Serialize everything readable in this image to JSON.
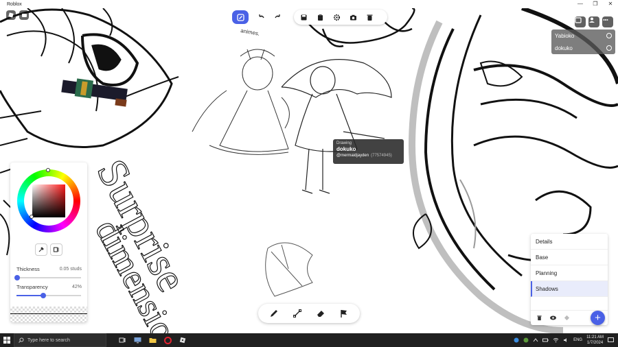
{
  "window": {
    "title": "Roblox",
    "controls": [
      "—",
      "❐",
      "✕"
    ]
  },
  "canvas_text": {
    "big_word_1": "Surprise",
    "big_word_2": "dimension",
    "small_note": "animes."
  },
  "players": [
    {
      "name": "Yabioko"
    },
    {
      "name": "dokuko"
    }
  ],
  "tooltip": {
    "label": "Drawing",
    "name": "dokuko",
    "handle": "@mermaidjayden",
    "user_id": "(77574945)"
  },
  "color_panel": {
    "thickness_label": "Thickness",
    "thickness_value": "0.05 studs",
    "thickness_fraction": 0.01,
    "transparency_label": "Transparency",
    "transparency_value": "42%",
    "transparency_fraction": 0.42,
    "selected_color": "#ff1a1a"
  },
  "layers": [
    {
      "name": "Details",
      "active": false
    },
    {
      "name": "Base",
      "active": false
    },
    {
      "name": "Planning",
      "active": false
    },
    {
      "name": "Shadows",
      "active": true
    }
  ],
  "colors": {
    "accent": "#4a61e6",
    "taskbar": "#202020"
  },
  "taskbar": {
    "search_placeholder": "Type here to search",
    "language": "ENG",
    "time": "11:21 AM",
    "date": "1/7/2024"
  }
}
